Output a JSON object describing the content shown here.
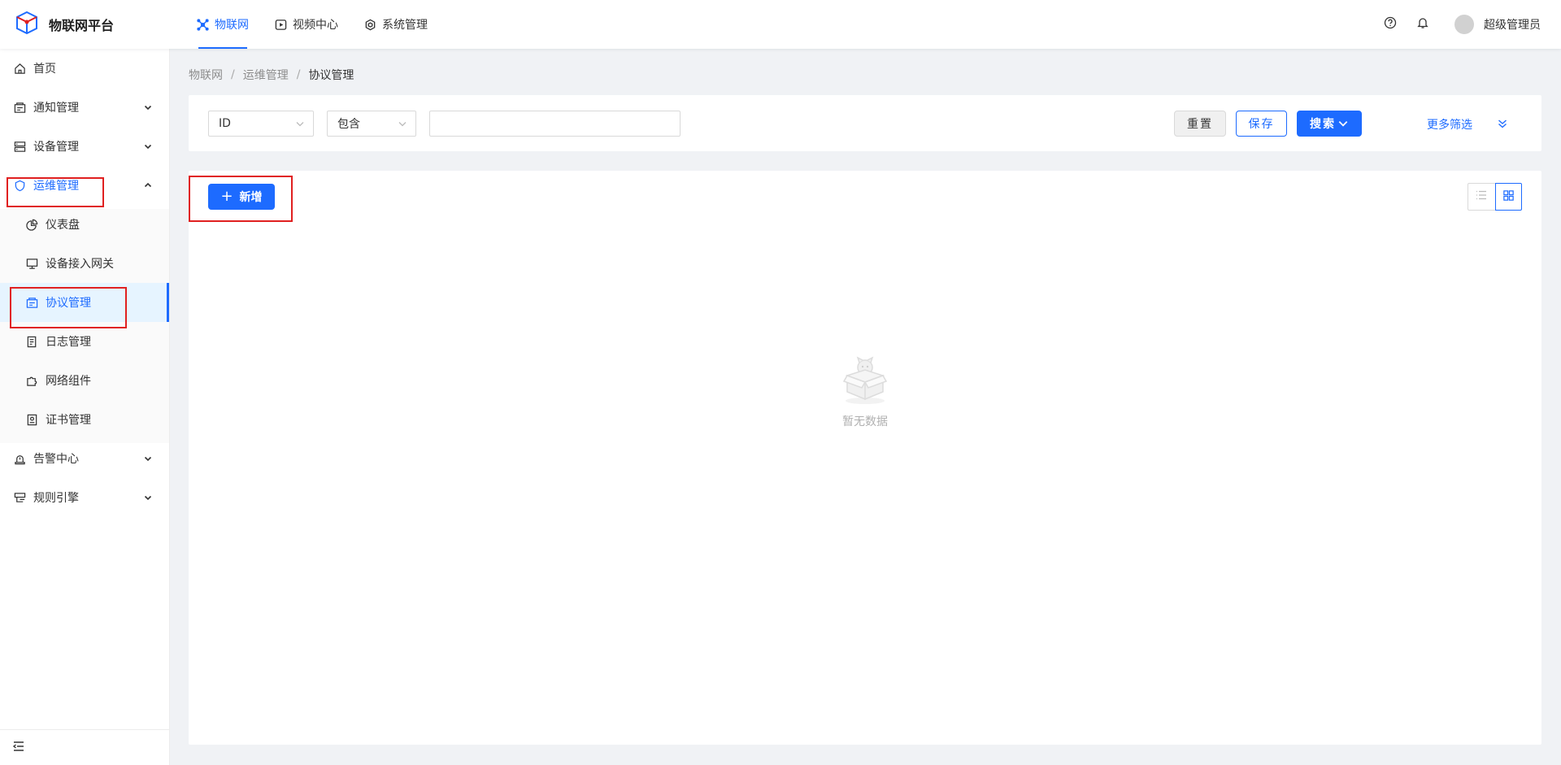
{
  "app": {
    "title": "物联网平台"
  },
  "topnav": [
    {
      "label": "物联网",
      "icon": "iot-icon",
      "active": true
    },
    {
      "label": "视频中心",
      "icon": "video-icon",
      "active": false
    },
    {
      "label": "系统管理",
      "icon": "system-icon",
      "active": false
    }
  ],
  "user": {
    "name": "超级管理员"
  },
  "sidebar": {
    "items": [
      {
        "label": "首页"
      },
      {
        "label": "通知管理"
      },
      {
        "label": "设备管理"
      },
      {
        "label": "运维管理"
      },
      {
        "label": "仪表盘"
      },
      {
        "label": "设备接入网关"
      },
      {
        "label": "协议管理"
      },
      {
        "label": "日志管理"
      },
      {
        "label": "网络组件"
      },
      {
        "label": "证书管理"
      },
      {
        "label": "告警中心"
      },
      {
        "label": "规则引擎"
      }
    ]
  },
  "breadcrumb": [
    "物联网",
    "运维管理",
    "协议管理"
  ],
  "filter": {
    "field": "ID",
    "operator": "包含",
    "value": "",
    "reset": "重置",
    "save": "保存",
    "search": "搜索",
    "more": "更多筛选"
  },
  "content": {
    "add": "新增",
    "empty": "暂无数据"
  },
  "colors": {
    "accent": "#1d6bff",
    "highlight": "#e02020"
  }
}
